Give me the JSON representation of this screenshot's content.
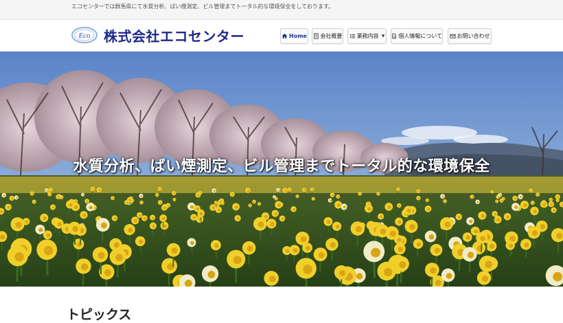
{
  "topbar": {
    "description": "エコセンターでは群馬県にて水質分析、ばい煙測定、ビル管理までトータル的な環境保全をしております。"
  },
  "header": {
    "logo_text": "Eco",
    "site_title": "株式会社エコセンター"
  },
  "nav": {
    "items": [
      {
        "label": "Home",
        "icon": "home-icon"
      },
      {
        "label": "会社概要",
        "icon": "document-icon"
      },
      {
        "label": "業務内容",
        "icon": "list-icon",
        "dropdown": true
      },
      {
        "label": "個人情報について",
        "icon": "file-icon"
      },
      {
        "label": "お問い合わせ",
        "icon": "envelope-icon"
      }
    ]
  },
  "hero": {
    "caption": "水質分析、ばい煙測定、ビル管理までトータル的な環境保全"
  },
  "main": {
    "topics_heading": "トピックス"
  },
  "colors": {
    "title_blue": "#1e2a8a",
    "sky": "#5f86c9",
    "daffodil": "#e8c21b",
    "stem_green": "#2f5a1e"
  }
}
